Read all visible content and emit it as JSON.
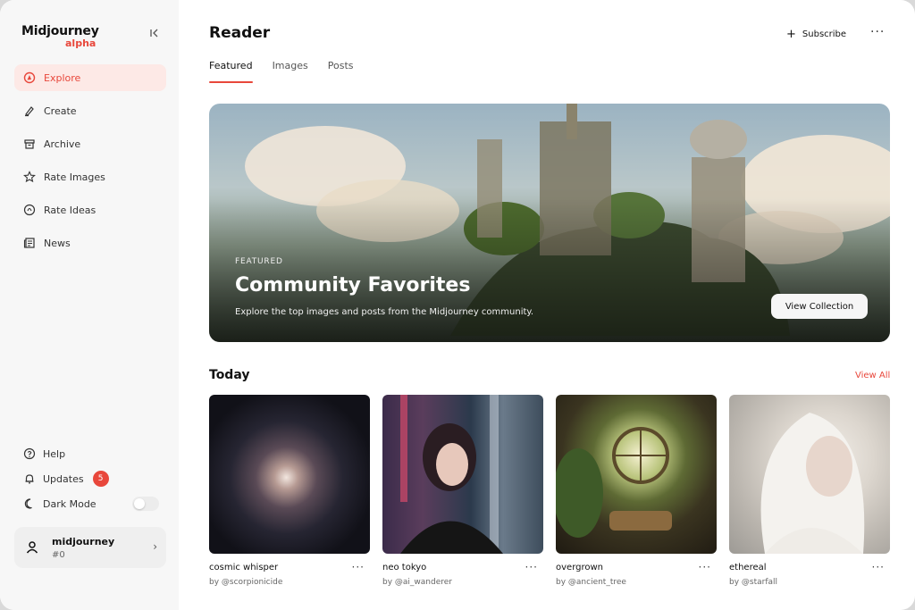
{
  "app": {
    "name": "Midjourney",
    "subtitle": "alpha"
  },
  "sidebar": {
    "nav": [
      {
        "label": "Explore",
        "icon": "compass-icon",
        "active": true
      },
      {
        "label": "Create",
        "icon": "brush-icon",
        "active": false
      },
      {
        "label": "Archive",
        "icon": "archive-icon",
        "active": false
      },
      {
        "label": "Rate Images",
        "icon": "star-icon",
        "active": false
      },
      {
        "label": "Rate Ideas",
        "icon": "lightbulb-icon",
        "active": false
      },
      {
        "label": "News",
        "icon": "newspaper-icon",
        "active": false
      }
    ],
    "bottom": {
      "help": "Help",
      "updates": "Updates",
      "updates_count": "5",
      "dark_mode": "Dark Mode",
      "dark_mode_enabled": false
    },
    "user": {
      "name": "midjourney",
      "id": "#0"
    }
  },
  "header": {
    "title": "Reader",
    "subscribe": "Subscribe",
    "tabs": [
      {
        "label": "Featured",
        "active": true
      },
      {
        "label": "Images",
        "active": false
      },
      {
        "label": "Posts",
        "active": false
      }
    ]
  },
  "hero": {
    "kicker": "FEATURED",
    "title": "Community Favorites",
    "description": "Explore the top images and posts from the Midjourney community.",
    "button": "View Collection"
  },
  "today": {
    "title": "Today",
    "view_all": "View All",
    "cards": [
      {
        "title": "cosmic whisper",
        "author": "by @scorpionicide"
      },
      {
        "title": "neo tokyo",
        "author": "by @ai_wanderer"
      },
      {
        "title": "overgrown",
        "author": "by @ancient_tree"
      },
      {
        "title": "ethereal",
        "author": "by @starfall"
      }
    ]
  },
  "colors": {
    "accent": "#e8473b",
    "sidebar_bg": "#f7f7f7",
    "active_bg": "#fde9e6"
  }
}
